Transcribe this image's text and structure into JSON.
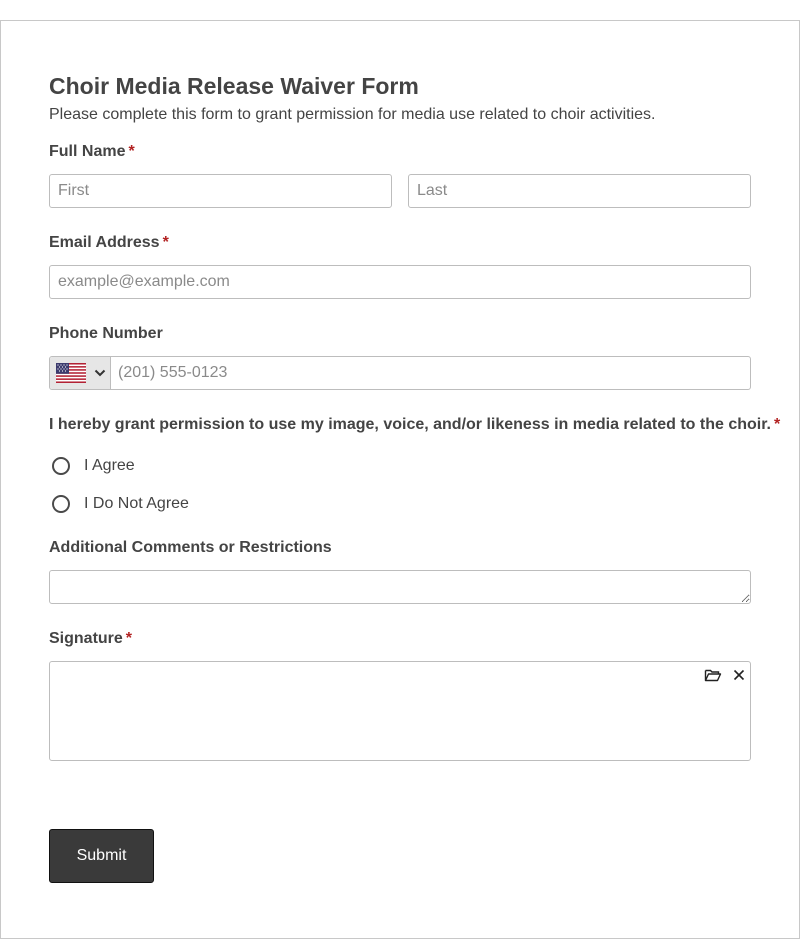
{
  "form": {
    "title": "Choir Media Release Waiver Form",
    "subtitle": "Please complete this form to grant permission for media use related to choir activities."
  },
  "full_name": {
    "label": "Full Name",
    "required_mark": "*",
    "first_placeholder": "First",
    "last_placeholder": "Last"
  },
  "email": {
    "label": "Email Address",
    "required_mark": "*",
    "placeholder": "example@example.com"
  },
  "phone": {
    "label": "Phone Number",
    "country_icon": "us-flag-icon",
    "placeholder": "(201) 555-0123"
  },
  "permission": {
    "label": "I hereby grant permission to use my image, voice, and/or likeness in media related to the choir.",
    "required_mark": "*",
    "options": [
      "I Agree",
      "I Do Not Agree"
    ]
  },
  "comments": {
    "label": "Additional Comments or Restrictions"
  },
  "signature": {
    "label": "Signature",
    "required_mark": "*",
    "upload_icon": "folder-open-icon",
    "clear_icon": "close-icon"
  },
  "submit": {
    "label": "Submit"
  },
  "colors": {
    "required": "#b22222",
    "button": "#3a3a3a",
    "border": "#bdbdbd",
    "text": "#444444"
  }
}
